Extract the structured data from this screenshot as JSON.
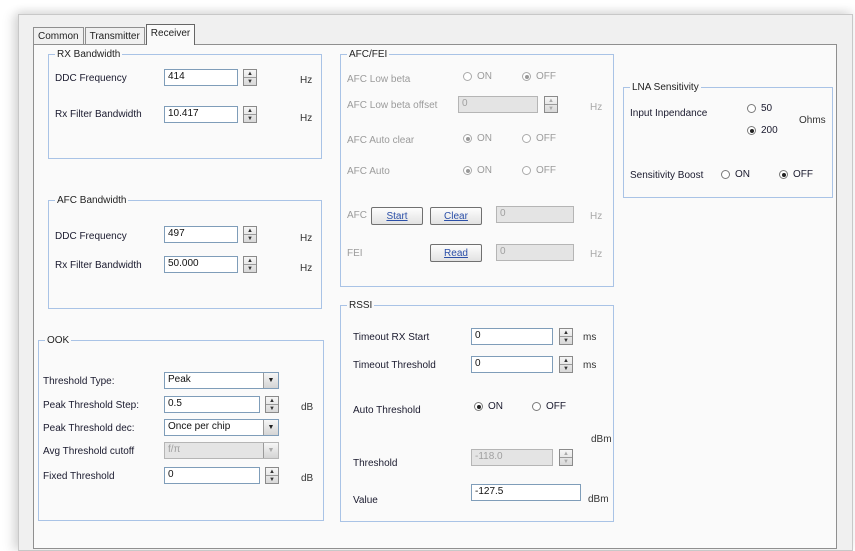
{
  "tabs": [
    "Common",
    "Transmitter",
    "Receiver"
  ],
  "rx_bandwidth": {
    "title": "RX Bandwidth",
    "ddc_label": "DDC Frequency",
    "ddc_value": "414",
    "ddc_unit": "Hz",
    "filter_label": "Rx Filter Bandwidth",
    "filter_value": "10.417",
    "filter_unit": "Hz"
  },
  "afc_bandwidth": {
    "title": "AFC Bandwidth",
    "ddc_label": "DDC Frequency",
    "ddc_value": "497",
    "ddc_unit": "Hz",
    "filter_label": "Rx Filter Bandwidth",
    "filter_value": "50.000",
    "filter_unit": "Hz"
  },
  "ook": {
    "title": "OOK",
    "threshold_type_label": "Threshold Type:",
    "threshold_type_value": "Peak",
    "peak_step_label": "Peak Threshold Step:",
    "peak_step_value": "0.5",
    "peak_step_unit": "dB",
    "peak_dec_label": "Peak Threshold dec:",
    "peak_dec_value": "Once per chip",
    "avg_cutoff_label": "Avg Threshold cutoff",
    "avg_cutoff_value": "f/π",
    "fixed_label": "Fixed Threshold",
    "fixed_value": "0",
    "fixed_unit": "dB"
  },
  "afc_fei": {
    "title": "AFC/FEI",
    "low_beta_label": "AFC Low beta",
    "low_beta_offset_label": "AFC Low beta offset",
    "low_beta_offset_value": "0",
    "low_beta_offset_unit": "Hz",
    "auto_clear_label": "AFC Auto clear",
    "auto_label": "AFC Auto",
    "on": "ON",
    "off": "OFF",
    "afc_label": "AFC",
    "start_button": "Start",
    "clear_button": "Clear",
    "afc_value": "0",
    "afc_unit": "Hz",
    "fei_label": "FEI",
    "read_button": "Read",
    "fei_value": "0",
    "fei_unit": "Hz"
  },
  "rssi": {
    "title": "RSSI",
    "timeout_rx_label": "Timeout RX Start",
    "timeout_rx_value": "0",
    "timeout_rx_unit": "ms",
    "timeout_thr_label": "Timeout Threshold",
    "timeout_thr_value": "0",
    "timeout_thr_unit": "ms",
    "auto_thr_label": "Auto Threshold",
    "on": "ON",
    "off": "OFF",
    "thr_unit": "dBm",
    "thr_label": "Threshold",
    "thr_value": "-118.0",
    "value_label": "Value",
    "value_value": "-127.5",
    "value_unit": "dBm"
  },
  "lna": {
    "title": "LNA Sensitivity",
    "impedance_label": "Input Inpendance",
    "opt_50": "50",
    "opt_200": "200",
    "ohms": "Ohms",
    "boost_label": "Sensitivity Boost",
    "on": "ON",
    "off": "OFF"
  }
}
